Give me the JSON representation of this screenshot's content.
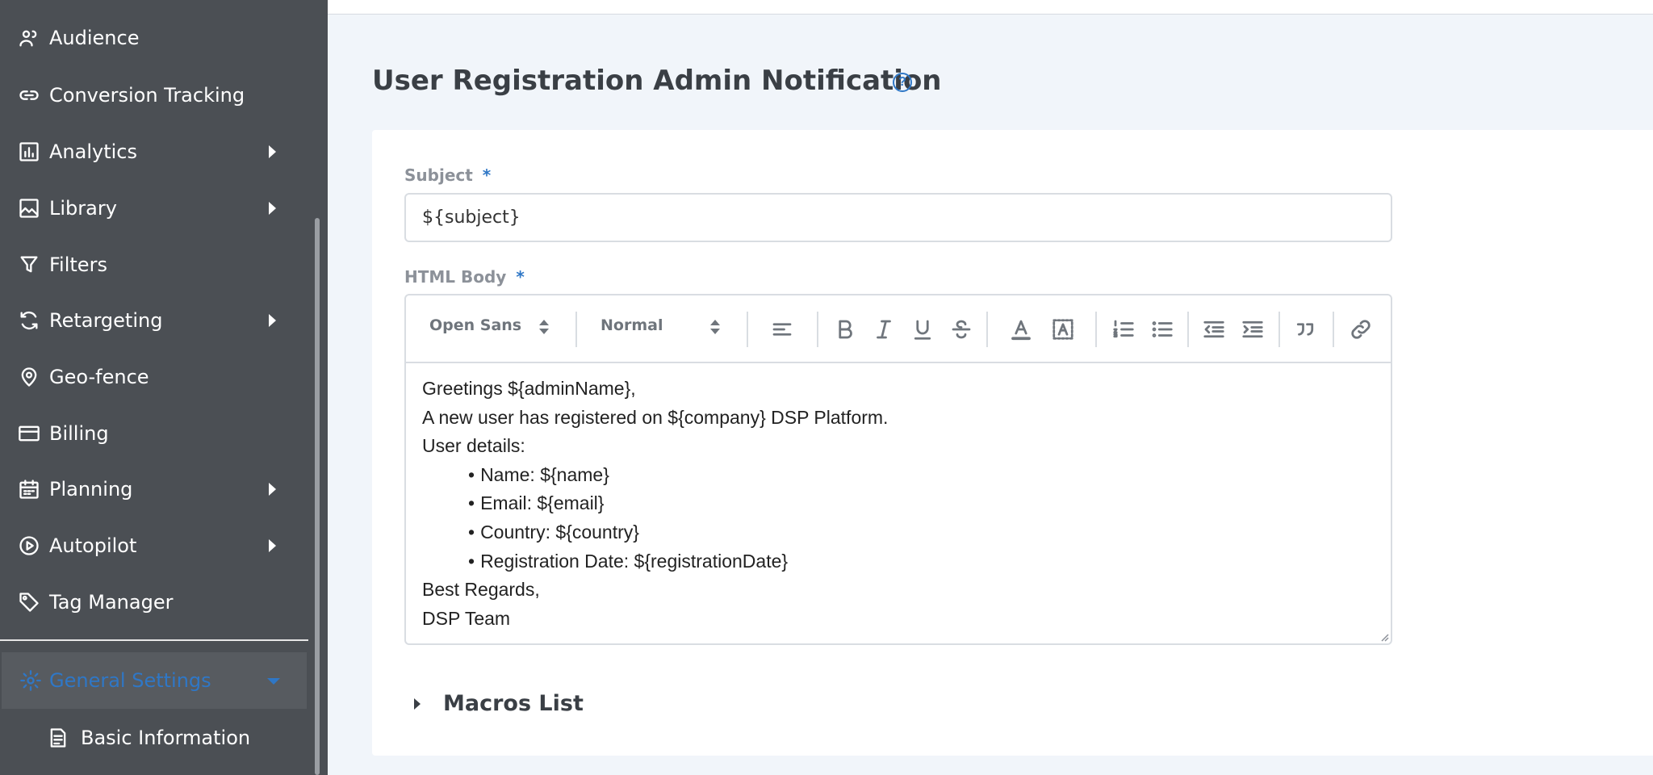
{
  "sidebar": {
    "items": [
      {
        "label": "Audience",
        "icon": "audience-icon"
      },
      {
        "label": "Conversion Tracking",
        "icon": "link-icon"
      },
      {
        "label": "Analytics",
        "icon": "bar-chart-icon"
      },
      {
        "label": "Library",
        "icon": "image-icon"
      },
      {
        "label": "Filters",
        "icon": "filter-icon"
      },
      {
        "label": "Retargeting",
        "icon": "refresh-icon"
      },
      {
        "label": "Geo-fence",
        "icon": "map-pin-icon"
      },
      {
        "label": "Billing",
        "icon": "credit-card-icon"
      },
      {
        "label": "Planning",
        "icon": "calendar-icon"
      },
      {
        "label": "Autopilot",
        "icon": "play-circle-icon"
      },
      {
        "label": "Tag Manager",
        "icon": "tag-icon"
      }
    ],
    "active": {
      "label": "General Settings",
      "icon": "gear-icon"
    },
    "sub_items": [
      {
        "label": "Basic Information",
        "icon": "document-icon"
      }
    ]
  },
  "page": {
    "title": "User Registration Admin Notification",
    "help": "?"
  },
  "form": {
    "subject_label": "Subject",
    "required_mark": "*",
    "subject_value": "${subject}",
    "body_label": "HTML Body",
    "toolbar": {
      "font": "Open Sans",
      "size": "Normal"
    },
    "body": {
      "greeting": "Greetings ${adminName},",
      "intro": "A new user has registered on ${company} DSP Platform.",
      "details_heading": "User details:",
      "details": [
        "Name: ${name}",
        "Email: ${email}",
        "Country: ${country}",
        "Registration Date: ${registrationDate}"
      ],
      "closing": "Best Regards,",
      "signature": "DSP Team"
    }
  },
  "macros": {
    "label": "Macros List"
  },
  "colors": {
    "sidebar": "#4b4f54",
    "accent": "#2f77c6",
    "background": "#f1f5fa"
  }
}
